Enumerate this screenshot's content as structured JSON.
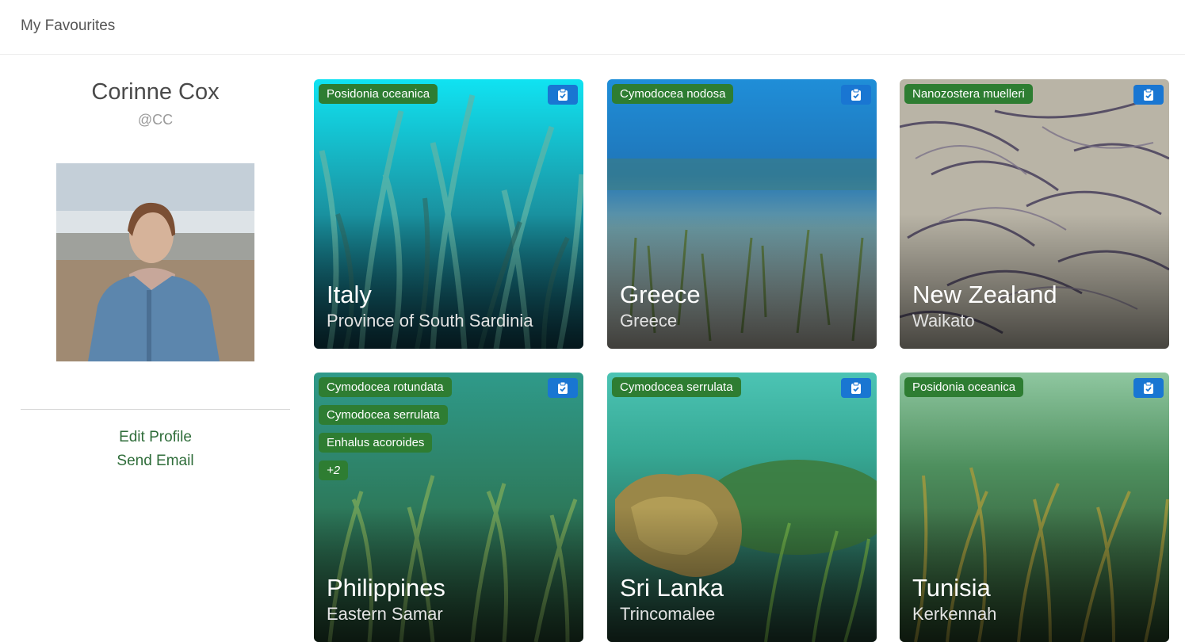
{
  "header": {
    "title": "My Favourites"
  },
  "profile": {
    "name": "Corinne Cox",
    "handle": "@CC",
    "links": {
      "edit": "Edit Profile",
      "email": "Send Email"
    }
  },
  "cards": [
    {
      "country": "Italy",
      "region": "Province of South Sardinia",
      "tags": [
        "Posidonia oceanica"
      ],
      "more": ""
    },
    {
      "country": "Greece",
      "region": "Greece",
      "tags": [
        "Cymodocea nodosa"
      ],
      "more": ""
    },
    {
      "country": "New Zealand",
      "region": "Waikato",
      "tags": [
        "Nanozostera muelleri"
      ],
      "more": ""
    },
    {
      "country": "Philippines",
      "region": "Eastern Samar",
      "tags": [
        "Cymodocea rotundata",
        "Cymodocea serrulata",
        "Enhalus acoroides"
      ],
      "more": "+2"
    },
    {
      "country": "Sri Lanka",
      "region": "Trincomalee",
      "tags": [
        "Cymodocea serrulata"
      ],
      "more": ""
    },
    {
      "country": "Tunisia",
      "region": "Kerkennah",
      "tags": [
        "Posidonia oceanica"
      ],
      "more": ""
    }
  ],
  "icons": {
    "card_action": "clipboard-check-icon"
  },
  "colors": {
    "tag_green": "#2e7d32",
    "action_blue": "#1976d2",
    "link_green": "#2f6d3a"
  }
}
